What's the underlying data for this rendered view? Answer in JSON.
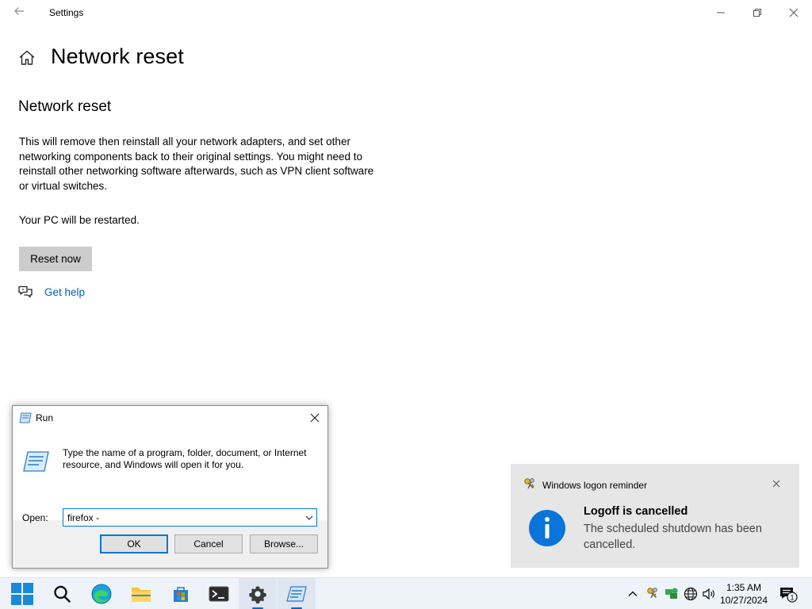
{
  "window": {
    "title": "Settings",
    "back_icon": "back-arrow-icon",
    "controls": [
      "minimize",
      "restore",
      "close"
    ]
  },
  "page": {
    "title": "Network reset",
    "home_icon": "home-icon"
  },
  "content": {
    "section_title": "Network reset",
    "description": "This will remove then reinstall all your network adapters, and set other networking components back to their original settings. You might need to reinstall other networking software afterwards, such as VPN client software or virtual switches.",
    "restart_note": "Your PC will be restarted.",
    "reset_button": "Reset now",
    "help_link": "Get help",
    "colors": {
      "link": "#0063b1",
      "button": "#cccccc"
    }
  },
  "run_dialog": {
    "title": "Run",
    "prompt": "Type the name of a program, folder, document, or Internet resource, and Windows will open it for you.",
    "open_label": "Open:",
    "open_value": "firefox -",
    "ok": "OK",
    "cancel": "Cancel",
    "browse": "Browse..."
  },
  "toast": {
    "app_name": "Windows logon reminder",
    "heading": "Logoff is cancelled",
    "message": "The scheduled shutdown has been cancelled.",
    "icon": "info-icon",
    "accent": "#0a74da"
  },
  "taskbar": {
    "items": [
      "start",
      "search",
      "edge",
      "file-explorer",
      "store",
      "terminal",
      "settings",
      "run"
    ],
    "tray": [
      "show-hidden-icons",
      "keys",
      "network-status",
      "language-globe",
      "volume"
    ],
    "time": "1:35 AM",
    "date": "10/27/2024",
    "notification_count": "1"
  }
}
